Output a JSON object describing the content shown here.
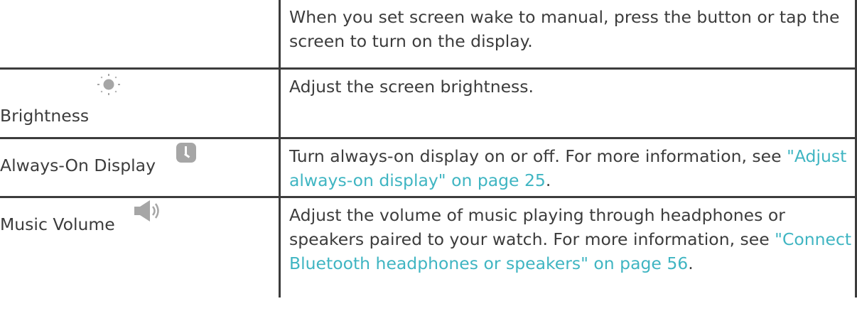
{
  "rows": [
    {
      "name": "",
      "icon": "",
      "description": "When you set screen wake to manual, press the button or tap the screen to turn on the display.",
      "link": "",
      "suffix": ""
    },
    {
      "name": "Brightness",
      "icon": "sun-icon",
      "description": "Adjust the screen brightness.",
      "link": "",
      "suffix": ""
    },
    {
      "name": "Always-On Display",
      "icon": "clock-icon",
      "description": "Turn always-on display on or off. For more information, see ",
      "link": "\"Adjust always-on display\" on page 25",
      "suffix": "."
    },
    {
      "name": "Music Volume",
      "icon": "speaker-icon",
      "description": "Adjust the volume of music playing through headphones or speakers paired to your watch. For more information, see ",
      "link": "\"Connect Bluetooth headphones or speakers\" on page 56",
      "suffix": "."
    }
  ],
  "colors": {
    "text": "#3c3c3c",
    "link": "#3fb5c2",
    "icon": "#a6a6a6",
    "border": "#3c3c3c"
  }
}
